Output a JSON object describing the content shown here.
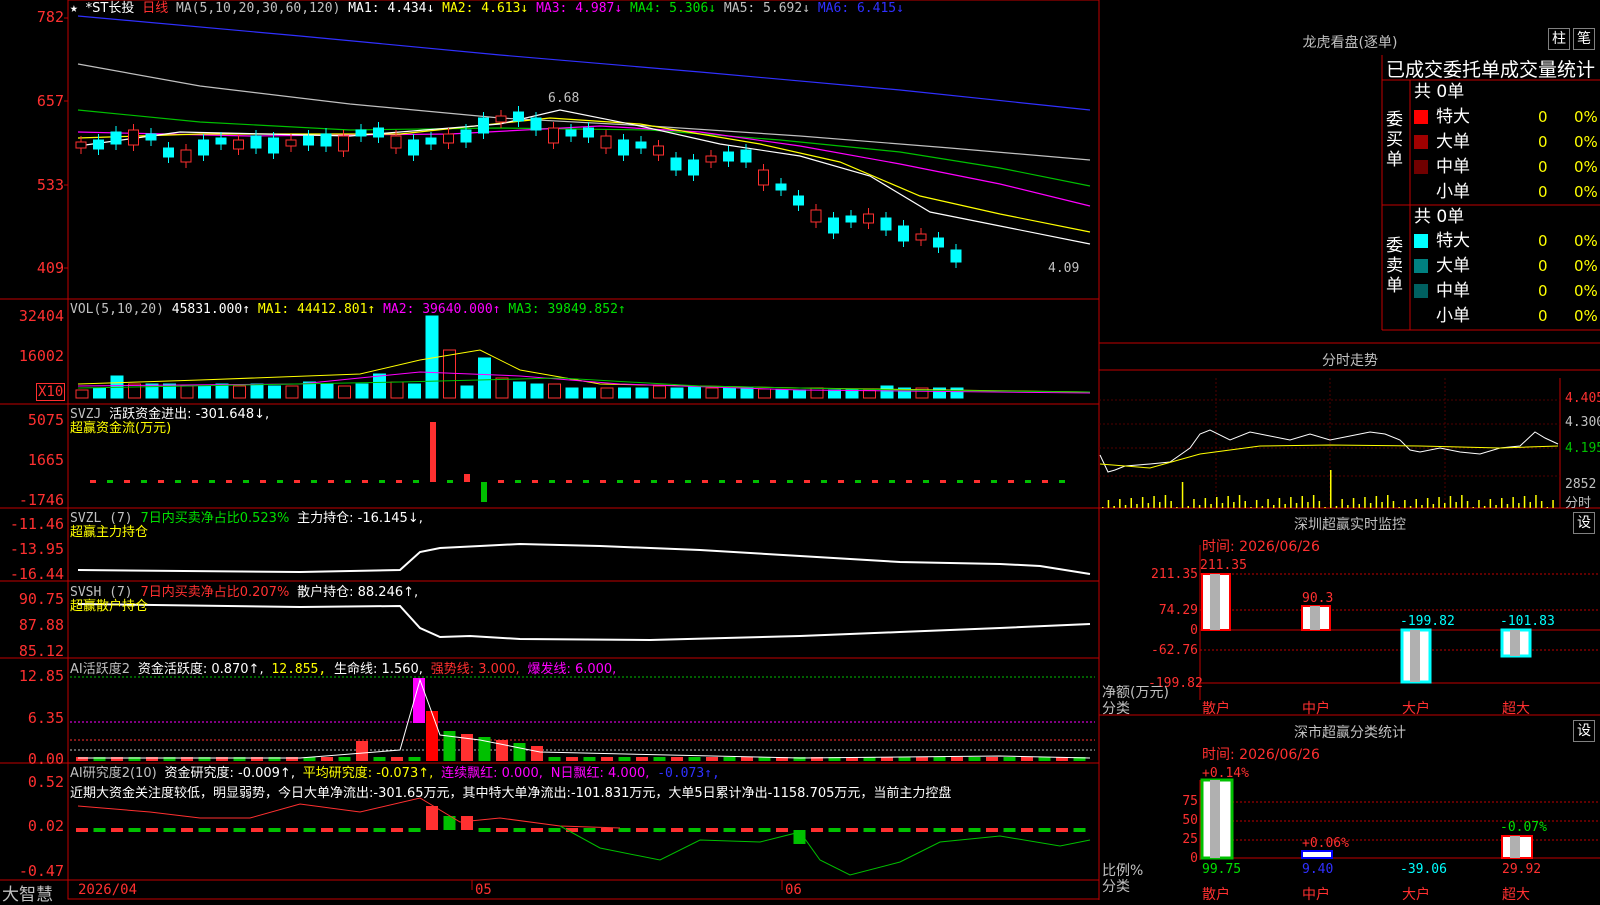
{
  "header": {
    "star": "★",
    "stock_name": "*ST长投",
    "period": "日线",
    "ma_params": "MA(5,10,20,30,60,120)",
    "ma1": "MA1: 4.434↓",
    "ma2": "MA2: 4.613↓",
    "ma3": "MA3: 4.987↓",
    "ma4": "MA4: 5.306↓",
    "ma5": "MA5: 5.692↓",
    "ma6": "MA6: 6.415↓"
  },
  "price_axis": [
    "782",
    "657",
    "533",
    "409"
  ],
  "price_labels": {
    "high": "6.68",
    "low": "4.09"
  },
  "vol": {
    "title": "VOL(5,10,20)",
    "value": "45831.000↑",
    "ma1": "MA1: 44412.801↑",
    "ma2": "MA2: 39640.000↑",
    "ma3": "MA3: 39849.852↑",
    "axis": [
      "32404",
      "16002"
    ],
    "unit": "X10"
  },
  "svzj": {
    "title": "SVZJ",
    "value": "活跃资金进出: -301.648↓,",
    "sub": "超赢资金流(万元)",
    "axis": [
      "5075",
      "1665",
      "-1746"
    ]
  },
  "svzl": {
    "title": "SVZL (7)",
    "ratio": "7日内买卖净占比0.523%",
    "value": "主力持仓: -16.145↓,",
    "sub": "超赢主力持仓",
    "axis": [
      "-11.46",
      "-13.95",
      "-16.44"
    ]
  },
  "svsh": {
    "title": "SVSH (7)",
    "ratio": "7日内买卖净占比0.207%",
    "value": "散户持仓: 88.246↑,",
    "sub": "超赢散户持仓",
    "axis": [
      "90.75",
      "87.88",
      "85.12"
    ]
  },
  "ai_active": {
    "title": "AI活跃度2",
    "v1": "资金活跃度: 0.870↑,",
    "v2": "12.855,",
    "v3": "生命线: 1.560,",
    "v4": "强势线: 3.000,",
    "v5": "爆发线: 6.000,",
    "axis": [
      "12.85",
      "6.35",
      "0.00"
    ]
  },
  "ai_research": {
    "title": "AI研究度2(10)",
    "v1": "资金研究度: -0.009↑,",
    "v2": "平均研究度: -0.073↑,",
    "v3": "连续飘红: 0.000,",
    "v4": "N日飘红: 4.000,",
    "v5": "-0.073↑,",
    "note": "近期大资金关注度较低，明显弱势，今日大单净流出:-301.65万元，其中特大单净流出:-101.831万元，大单5日累计净出-1158.705万元，当前主力控盘",
    "axis": [
      "0.52",
      "0.02",
      "-0.47"
    ]
  },
  "bottom": {
    "brand": "大智慧",
    "date": "2026/04",
    "m5": "05",
    "m6": "06"
  },
  "right": {
    "lhb_title": "龙虎看盘(逐单)",
    "btn1": "柱",
    "btn2": "笔",
    "stats_title": "已成交委托单成交量统计",
    "buy_total": "共 0单",
    "sell_total": "共 0单",
    "buy_label": "委买单",
    "sell_label": "委卖单",
    "buy_rows": [
      {
        "name": "特大",
        "v": "0",
        "p": "0%",
        "color": "#ff0000"
      },
      {
        "name": "大单",
        "v": "0",
        "p": "0%",
        "color": "#a00000"
      },
      {
        "name": "中单",
        "v": "0",
        "p": "0%",
        "color": "#700000"
      },
      {
        "name": "小单",
        "v": "0",
        "p": "0%",
        "color": ""
      }
    ],
    "sell_rows": [
      {
        "name": "特大",
        "v": "0",
        "p": "0%",
        "color": "#00ffff"
      },
      {
        "name": "大单",
        "v": "0",
        "p": "0%",
        "color": "#008080"
      },
      {
        "name": "中单",
        "v": "0",
        "p": "0%",
        "color": "#006060"
      },
      {
        "name": "小单",
        "v": "0",
        "p": "0%",
        "color": ""
      }
    ],
    "fs_title": "分时走势",
    "fs_axis": [
      "4.405",
      "4.300",
      "4.195",
      "2852",
      "分时"
    ],
    "sz_title": "深圳超赢实时监控",
    "sz_btn": "设",
    "sz_time": "时间: 2026/06/26",
    "sz_axis": [
      "211.35",
      "74.29",
      "0",
      "-62.76",
      "-199.82"
    ],
    "sz_vals": [
      "211.35",
      "90.3",
      "-199.82",
      "-101.83"
    ],
    "sz_ylabel": "净额(万元)",
    "sz_xlabel": "分类",
    "cats": [
      "散户",
      "中户",
      "大户",
      "超大"
    ],
    "ss_title": "深市超赢分类统计",
    "ss_btn": "设",
    "ss_time": "时间: 2026/06/26",
    "ss_axis": [
      "75",
      "50",
      "25",
      "0"
    ],
    "ss_tops": [
      "+0.14%",
      "+0.06%",
      "-0.07%"
    ],
    "ss_vals": [
      "99.75",
      "9.40",
      "-39.06",
      "29.92"
    ],
    "ss_ylabel": "比例%",
    "ss_xlabel": "分类"
  }
}
